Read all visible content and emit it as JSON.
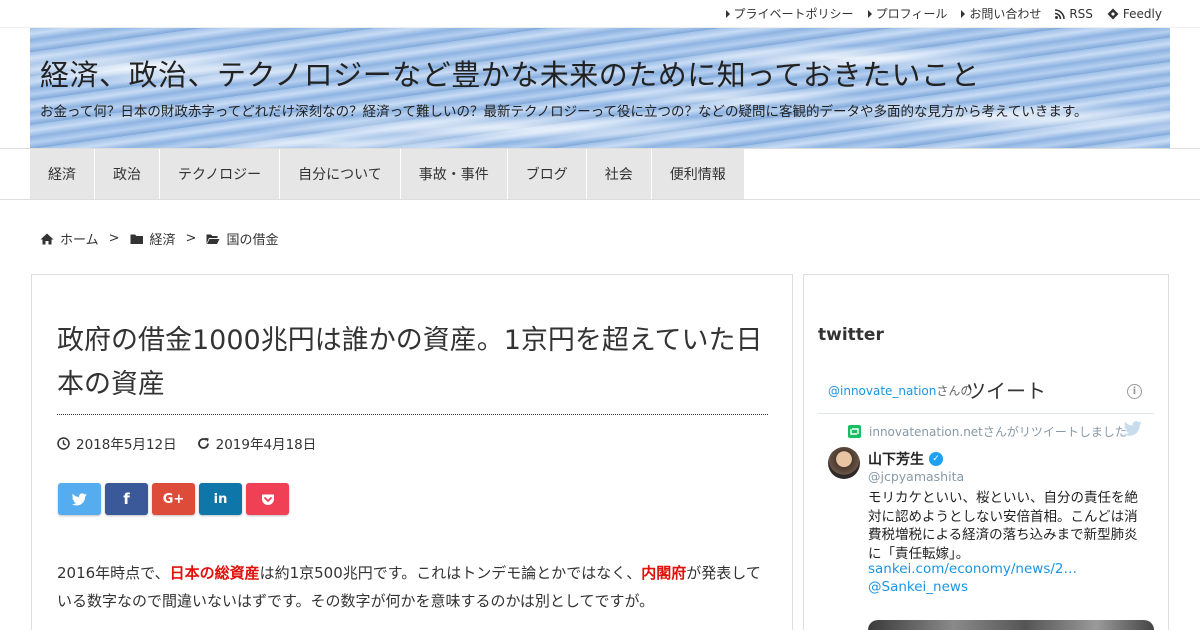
{
  "topnav": {
    "items": [
      "プライベートポリシー",
      "プロフィール",
      "お問い合わせ"
    ],
    "rss_label": "RSS",
    "feedly_label": "Feedly"
  },
  "header": {
    "site_title": "経済、政治、テクノロジーなど豊かな未来のために知っておきたいこと",
    "site_description": "お金って何？日本の財政赤字ってどれだけ深刻なの？経済って難しいの？最新テクノロジーって役に立つの？などの疑問に客観的データや多面的な見方から考えていきます。"
  },
  "mainnav": {
    "items": [
      "経済",
      "政治",
      "テクノロジー",
      "自分について",
      "事故・事件",
      "ブログ",
      "社会",
      "便利情報"
    ]
  },
  "breadcrumb": {
    "home": "ホーム",
    "category": "経済",
    "subcategory": "国の借金",
    "separator": ">"
  },
  "article": {
    "title": "政府の借金1000兆円は誰かの資産。1京円を超えていた日本の資産",
    "published": "2018年5月12日",
    "updated": "2019年4月18日",
    "share": {
      "twitter": "t",
      "facebook": "f",
      "googleplus": "G+",
      "linkedin": "in",
      "pocket": "p",
      "colors": {
        "twitter": "#55acee",
        "facebook": "#3b5998",
        "googleplus": "#dd4b39",
        "linkedin": "#0e76a8",
        "pocket": "#ef4056"
      }
    },
    "body": {
      "part1": "2016年時点で、",
      "highlight1": "日本の総資産",
      "part2": "は約1京500兆円です。これはトンデモ論とかではなく、",
      "highlight2": "内閣府",
      "part3": "が発表している数字なので間違いないはずです。その数字が何かを意味するのかは別としてですが。"
    },
    "highlight_color": "#e0110b"
  },
  "sidebar": {
    "widget_title": "twitter",
    "timeline": {
      "handle": "@innovate_nation",
      "handle_suffix": "さんの",
      "tweets_word": "ツイート",
      "info_icon": "i",
      "retweet_notice": "innovatenation.netさんがリツイートしました",
      "author_name": "山下芳生",
      "author_handle": "@jcpyamashita",
      "verified_mark": "✓",
      "text": "モリカケといい、桜といい、自分の責任を絶対に認めようとしない安倍首相。こんどは消費税増税による経済の落ち込みまで新型肺炎に「責任転嫁」。",
      "link": "sankei.com/economy/news/2…",
      "mention": "@Sankei_news"
    }
  }
}
